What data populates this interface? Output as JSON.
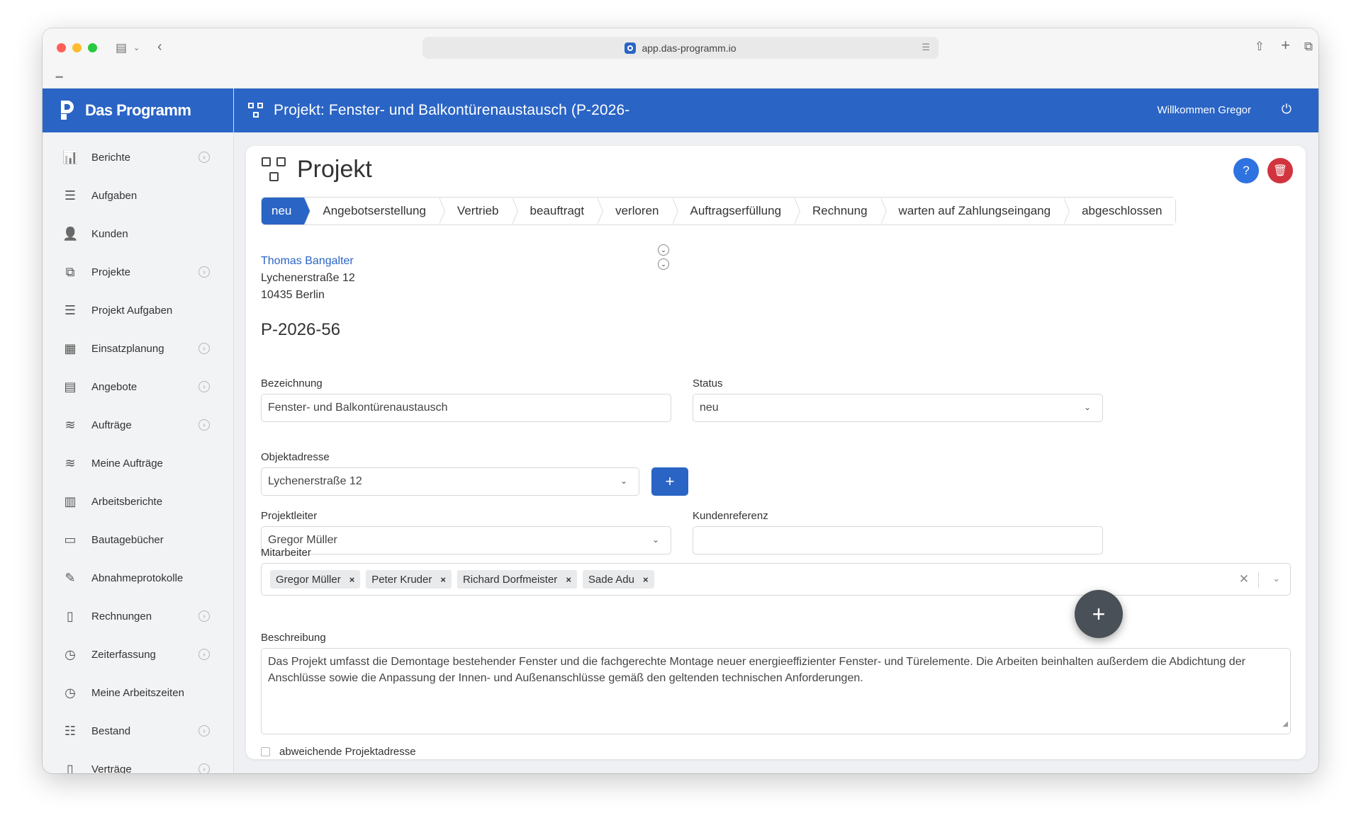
{
  "browser": {
    "url": "app.das-programm.io"
  },
  "brand": {
    "name": "Das Programm",
    "color": "#2a64c5"
  },
  "sidebar": {
    "items": [
      {
        "label": "Berichte",
        "icon": "chart-icon",
        "expandable": true
      },
      {
        "label": "Aufgaben",
        "icon": "checklist-icon",
        "expandable": false
      },
      {
        "label": "Kunden",
        "icon": "contact-icon",
        "expandable": false
      },
      {
        "label": "Projekte",
        "icon": "project-icon",
        "expandable": true
      },
      {
        "label": "Projekt Aufgaben",
        "icon": "checklist-icon",
        "expandable": false
      },
      {
        "label": "Einsatzplanung",
        "icon": "calendar-icon",
        "expandable": true
      },
      {
        "label": "Angebote",
        "icon": "calculator-icon",
        "expandable": true
      },
      {
        "label": "Aufträge",
        "icon": "handshake-icon",
        "expandable": true
      },
      {
        "label": "Meine Aufträge",
        "icon": "handshake-icon",
        "expandable": false
      },
      {
        "label": "Arbeitsberichte",
        "icon": "report-icon",
        "expandable": false
      },
      {
        "label": "Bautagebücher",
        "icon": "book-icon",
        "expandable": false
      },
      {
        "label": "Abnahmeprotokolle",
        "icon": "signature-icon",
        "expandable": false
      },
      {
        "label": "Rechnungen",
        "icon": "invoice-icon",
        "expandable": true
      },
      {
        "label": "Zeiterfassung",
        "icon": "clock-icon",
        "expandable": true
      },
      {
        "label": "Meine Arbeitszeiten",
        "icon": "clock-icon",
        "expandable": false
      },
      {
        "label": "Bestand",
        "icon": "inventory-icon",
        "expandable": true
      },
      {
        "label": "Verträge",
        "icon": "contract-icon",
        "expandable": true
      }
    ]
  },
  "topbar": {
    "title": "Projekt: Fenster- und Balkontürenaustausch (P-2026-",
    "welcome": "Willkommen Gregor"
  },
  "page": {
    "title": "Projekt",
    "help_label": "?"
  },
  "steps": [
    {
      "label": "neu",
      "active": true
    },
    {
      "label": "Angebotserstellung",
      "active": false
    },
    {
      "label": "Vertrieb",
      "active": false
    },
    {
      "label": "beauftragt",
      "active": false
    },
    {
      "label": "verloren",
      "active": false
    },
    {
      "label": "Auftragserfüllung",
      "active": false
    },
    {
      "label": "Rechnung",
      "active": false
    },
    {
      "label": "warten auf Zahlungseingang",
      "active": false
    },
    {
      "label": "abgeschlossen",
      "active": false
    }
  ],
  "customer": {
    "name": "Thomas Bangalter",
    "street": "Lychenerstraße 12",
    "city": "10435 Berlin"
  },
  "project": {
    "number": "P-2026-56"
  },
  "form": {
    "bezeichnung_label": "Bezeichnung",
    "bezeichnung_value": "Fenster- und Balkontürenaustausch",
    "status_label": "Status",
    "status_value": "neu",
    "objektadresse_label": "Objektadresse",
    "objektadresse_value": "Lychenerstraße 12",
    "add_label": "+",
    "projektleiter_label": "Projektleiter",
    "projektleiter_value": "Gregor Müller",
    "kundenreferenz_label": "Kundenreferenz",
    "kundenreferenz_value": "",
    "mitarbeiter_label": "Mitarbeiter",
    "mitarbeiter": [
      "Gregor Müller",
      "Peter Kruder",
      "Richard Dorfmeister",
      "Sade Adu"
    ],
    "beschreibung_label": "Beschreibung",
    "beschreibung_value": "Das Projekt umfasst die Demontage bestehender Fenster und die fachgerechte Montage neuer energieeffizienter Fenster- und Türelemente. Die Arbeiten beinhalten außerdem die Abdichtung der Anschlüsse sowie die Anpassung der Innen- und Außenanschlüsse gemäß den geltenden technischen Anforderungen.",
    "abweichende_label": "abweichende Projektadresse"
  },
  "fab": {
    "label": "+"
  },
  "colors": {
    "primary": "#2a64c5",
    "danger": "#d1343e",
    "help": "#2f73e0",
    "fab": "#4a5057"
  }
}
